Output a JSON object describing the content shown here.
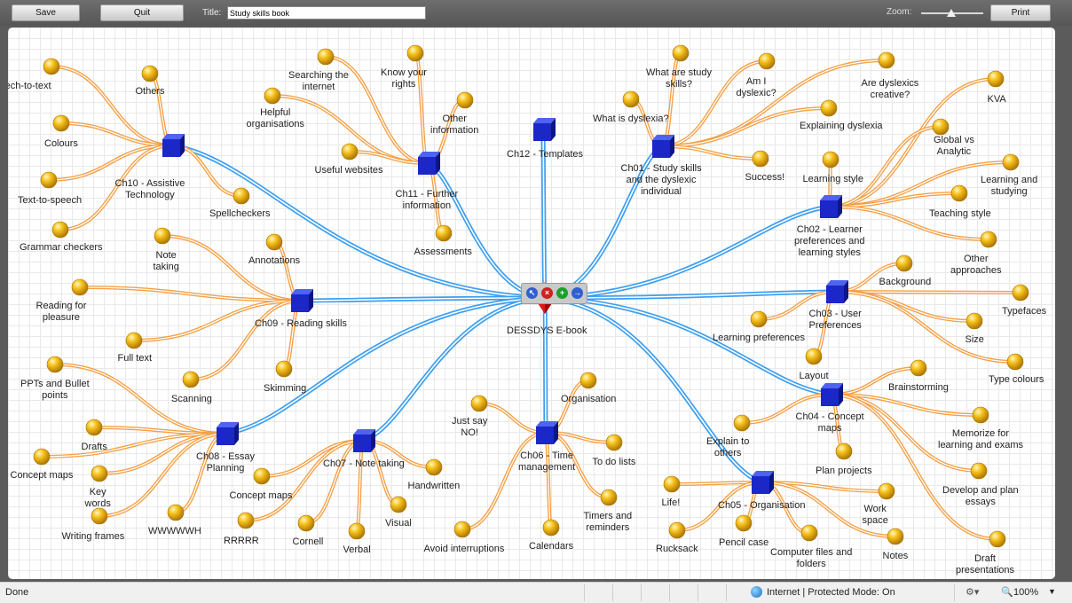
{
  "toolbar": {
    "save_label": "Save",
    "quit_label": "Quit",
    "title_label": "Title:",
    "title_value": "Study skills book",
    "zoom_label": "Zoom:",
    "zoom_level": 0.5,
    "print_label": "Print"
  },
  "mindmap": {
    "root": "DESSDYS E-book",
    "node_controls": [
      "pointer-icon",
      "delete-icon",
      "add-icon",
      "next-icon"
    ],
    "colors": {
      "branch": "#3d9ff0",
      "leaf_line": "#f4a046",
      "leaf_ball": "#f2b21a",
      "chapter": "#1c27c8",
      "root": "#e01818"
    },
    "chapters": [
      {
        "id": "ch10",
        "label": "Ch10 - Assistive\nTechnology",
        "topics": [
          "Speech-to-text",
          "Others",
          "Colours",
          "Text-to-speech",
          "Grammar checkers",
          "Spellcheckers"
        ]
      },
      {
        "id": "ch11",
        "label": "Ch11 - Further\ninformation",
        "topics": [
          "Searching the\ninternet",
          "Know your\nrights",
          "Helpful\norganisations",
          "Other\ninformation",
          "Useful websites",
          "Assessments"
        ]
      },
      {
        "id": "ch12",
        "label": "Ch12 - Templates",
        "topics": []
      },
      {
        "id": "ch01",
        "label": "Ch01 - Study skills\nand the dyslexic\nindividual",
        "topics": [
          "What are study\nskills?",
          "Am I\ndyslexic?",
          "Are dyslexics\ncreative?",
          "What is dyslexia?",
          "Explaining dyslexia",
          "Success!"
        ]
      },
      {
        "id": "ch02",
        "label": "Ch02 - Learner\npreferences and\nlearning styles",
        "topics": [
          "KVA",
          "Global vs\nAnalytic",
          "Learning style",
          "Learning and\nstudying",
          "Teaching style",
          "Other\napproaches"
        ]
      },
      {
        "id": "ch09",
        "label": "Ch09 - Reading skills",
        "topics": [
          "Note\ntaking",
          "Annotations",
          "Reading for\npleasure",
          "Full text",
          "Scanning",
          "Skimming"
        ]
      },
      {
        "id": "ch03",
        "label": "Ch03 - User\nPreferences",
        "topics": [
          "Background",
          "Typefaces",
          "Learning preferences",
          "Size",
          "Layout",
          "Type colours"
        ]
      },
      {
        "id": "ch08",
        "label": "Ch08 - Essay\nPlanning",
        "topics": [
          "PPTs and Bullet\npoints",
          "Drafts",
          "Concept maps",
          "Key\nwords",
          "Writing frames",
          "WWWWWH"
        ]
      },
      {
        "id": "ch07",
        "label": "Ch07 - Note taking",
        "topics": [
          "Concept maps",
          "RRRRR",
          "Cornell",
          "Verbal",
          "Visual",
          "Handwritten"
        ]
      },
      {
        "id": "ch06",
        "label": "Ch06 - Time\nmanagement",
        "topics": [
          "Just say\nNO!",
          "Organisation",
          "To do lists",
          "Timers and\nreminders",
          "Calendars",
          "Avoid interruptions"
        ]
      },
      {
        "id": "ch04",
        "label": "Ch04 - Concept\nmaps",
        "topics": [
          "Brainstorming",
          "Memorize for\nlearning and exams",
          "Explain to\nothers",
          "Plan projects",
          "Develop and plan\nessays",
          "Draft\npresentations"
        ]
      },
      {
        "id": "ch05",
        "label": "Ch05 - Organisation",
        "topics": [
          "Life!",
          "Work\nspace",
          "Rucksack",
          "Pencil case",
          "Computer files and\nfolders",
          "Notes"
        ]
      }
    ]
  },
  "statusbar": {
    "status": "Done",
    "zone": "Internet | Protected Mode: On",
    "zoom": "100%"
  }
}
